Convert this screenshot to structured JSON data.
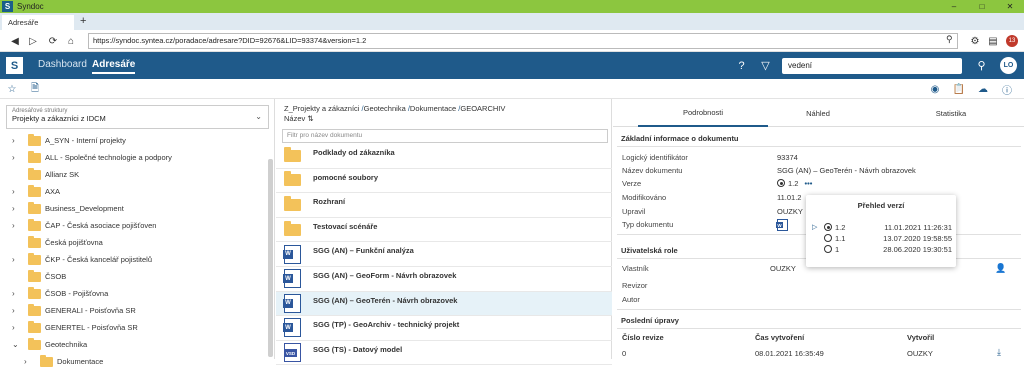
{
  "window": {
    "app_title": "Syndoc",
    "app_icon_letter": "S",
    "minimize": "–",
    "maximize": "□",
    "close": "✕"
  },
  "browser": {
    "tab_label": "Adresáře",
    "newtab": "+",
    "url": "https://syndoc.syntea.cz/poradace/adresare?DID=92676&LID=93374&version=1.2",
    "ext_badge": "13"
  },
  "appbar": {
    "logo": "S",
    "nav": [
      {
        "label": "Dashboard"
      },
      {
        "label": "Adresáře"
      }
    ],
    "search_value": "vedení",
    "avatar": "LO"
  },
  "left": {
    "structure_label": "Adresářové struktury",
    "structure_value": "Projekty a zákazníci z IDCM",
    "tree": [
      {
        "label": "A_SYN - Interní projekty",
        "arrow": "›"
      },
      {
        "label": "ALL - Společné technologie a podpory",
        "arrow": "›"
      },
      {
        "label": "Allianz SK",
        "arrow": ""
      },
      {
        "label": "AXA",
        "arrow": "›"
      },
      {
        "label": "Business_Development",
        "arrow": "›"
      },
      {
        "label": "ČAP - Česká asociace pojišťoven",
        "arrow": "›"
      },
      {
        "label": "Česká pojišťovna",
        "arrow": ""
      },
      {
        "label": "ČKP - Česká kancelář pojistitelů",
        "arrow": "›"
      },
      {
        "label": "ČSOB",
        "arrow": ""
      },
      {
        "label": "ČSOB - Pojišťovna",
        "arrow": "›"
      },
      {
        "label": "GENERALI - Poisťovňa SR",
        "arrow": "›"
      },
      {
        "label": "GENERTEL - Poisťovňa SR",
        "arrow": "›"
      },
      {
        "label": "Geotechnika",
        "arrow": "⌄"
      },
      {
        "label": "Dokumentace",
        "arrow": "›"
      }
    ]
  },
  "middle": {
    "breadcrumb": [
      "Z_Projekty a zákazníci",
      "Geotechnika",
      "Dokumentace",
      "GEOARCHIV"
    ],
    "breadcrumb_sep": " /",
    "column_header": "Název ⇅",
    "filter_placeholder": "Filtr pro název dokumentu",
    "docs": [
      {
        "name": "Podklady od zákazníka",
        "type": "folder"
      },
      {
        "name": "pomocné soubory",
        "type": "folder"
      },
      {
        "name": "Rozhraní",
        "type": "folder"
      },
      {
        "name": "Testovací scénáře",
        "type": "folder"
      },
      {
        "name": "SGG (AN) – Funkční analýza",
        "type": "word"
      },
      {
        "name": "SGG (AN) – GeoForm - Návrh obrazovek",
        "type": "word"
      },
      {
        "name": "SGG (AN) – GeoTerén - Návrh obrazovek",
        "type": "word",
        "selected": true
      },
      {
        "name": "SGG (TP) - GeoArchiv - technický projekt",
        "type": "word"
      },
      {
        "name": "SGG (TS) - Datový model",
        "type": "vsd"
      }
    ]
  },
  "right": {
    "tabs": [
      "Podrobnosti",
      "Náhled",
      "Statistika"
    ],
    "basic_title": "Základní informace o dokumentu",
    "props": [
      {
        "label": "Logický identifikátor",
        "value": "93374"
      },
      {
        "label": "Název dokumentu",
        "value": "SGG (AN) – GeoTerén - Návrh obrazovek"
      },
      {
        "label": "Verze",
        "value": "1.2"
      },
      {
        "label": "Modifikováno",
        "value": "11.01.2"
      },
      {
        "label": "Upravil",
        "value": "OUZKY"
      },
      {
        "label": "Typ dokumentu",
        "value": ""
      }
    ],
    "version_more": "•••",
    "role_title": "Uživatelská role",
    "roles": [
      {
        "label": "Vlastník",
        "value": "OUZKY"
      },
      {
        "label": "Revizor",
        "value": ""
      },
      {
        "label": "Autor",
        "value": ""
      }
    ],
    "last_title": "Poslední úpravy",
    "last_headers": [
      "Číslo revize",
      "Čas vytvoření",
      "Vytvořil"
    ],
    "last_row": [
      "0",
      "08.01.2021 16:35:49",
      "OUZKY"
    ],
    "popup": {
      "title": "Přehled verzí",
      "versions": [
        {
          "version": "1.2",
          "date": "11.01.2021 11:26:31",
          "current": true
        },
        {
          "version": "1.1",
          "date": "13.07.2020 19:58:55",
          "current": false
        },
        {
          "version": "1",
          "date": "28.06.2020 19:30:51",
          "current": false
        }
      ]
    }
  },
  "colors": {
    "appbar": "#1f5a8a",
    "titlebar": "#8cc63f",
    "folder": "#f3c25a",
    "selected_row": "#e6f2f8"
  }
}
